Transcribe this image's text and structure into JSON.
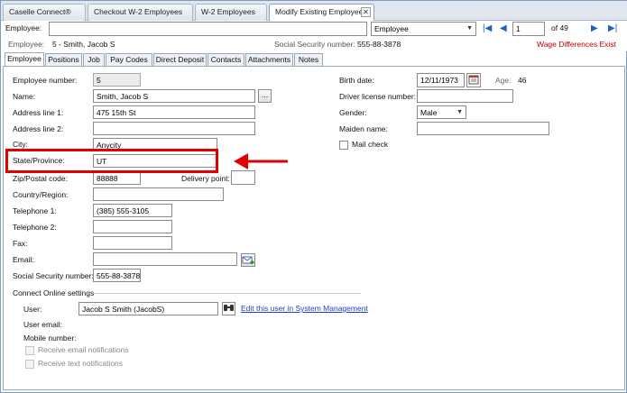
{
  "doc_tabs": [
    {
      "label": "Caselle Connect®"
    },
    {
      "label": "Checkout W-2 Employees"
    },
    {
      "label": "W-2 Employees"
    },
    {
      "label": "Modify Existing Employees"
    }
  ],
  "emp_bar": {
    "label": "Employee:",
    "search_value": "",
    "type_select": "Employee",
    "record_number": "1",
    "record_total": "of 49"
  },
  "sub_bar": {
    "employee_label": "Employee:",
    "employee_value": "5 - Smith, Jacob S",
    "ssn_label": "Social Security number:",
    "ssn_value": "555-88-3878",
    "warning": "Wage Differences Exist"
  },
  "sec_tabs": [
    "Employee",
    "Positions",
    "Job",
    "Pay Codes",
    "Direct Deposit",
    "Contacts",
    "Attachments",
    "Notes"
  ],
  "form": {
    "employee_number_label": "Employee number:",
    "employee_number": "5",
    "name_label": "Name:",
    "name": "Smith, Jacob S",
    "name_button": "...",
    "address1_label": "Address line 1:",
    "address1": "475 15th St",
    "address2_label": "Address line 2:",
    "address2": "",
    "city_label": "City:",
    "city": "Anycity",
    "state_label": "State/Province:",
    "state": "UT",
    "zip_label": "Zip/Postal code:",
    "zip": "88888",
    "delivery_label": "Delivery point:",
    "delivery": "",
    "country_label": "Country/Region:",
    "country": "",
    "tel1_label": "Telephone 1:",
    "tel1": "(385) 555-3105",
    "tel2_label": "Telephone 2:",
    "tel2": "",
    "fax_label": "Fax:",
    "fax": "",
    "email_label": "Email:",
    "email": "",
    "ssn_label": "Social Security number:",
    "ssn": "555-88-3878",
    "connect_heading": "Connect Online settings",
    "user_label": "User:",
    "user_value": "Jacob S Smith (JacobS)",
    "edit_link": "Edit this user in System Management",
    "user_email_label": "User email:",
    "mobile_label": "Mobile number:",
    "receive_email": "Receive email notifications",
    "receive_text": "Receive text notifications",
    "birth_label": "Birth date:",
    "birth": "12/11/1973",
    "age_label": "Age:",
    "age": "46",
    "driver_label": "Driver license number:",
    "driver": "",
    "gender_label": "Gender:",
    "gender": "Male",
    "maiden_label": "Maiden name:",
    "maiden": "",
    "mail_check_label": "Mail check"
  },
  "colors": {
    "highlight": "#e00000",
    "warning": "#c00000",
    "link": "#1a3fd0"
  }
}
